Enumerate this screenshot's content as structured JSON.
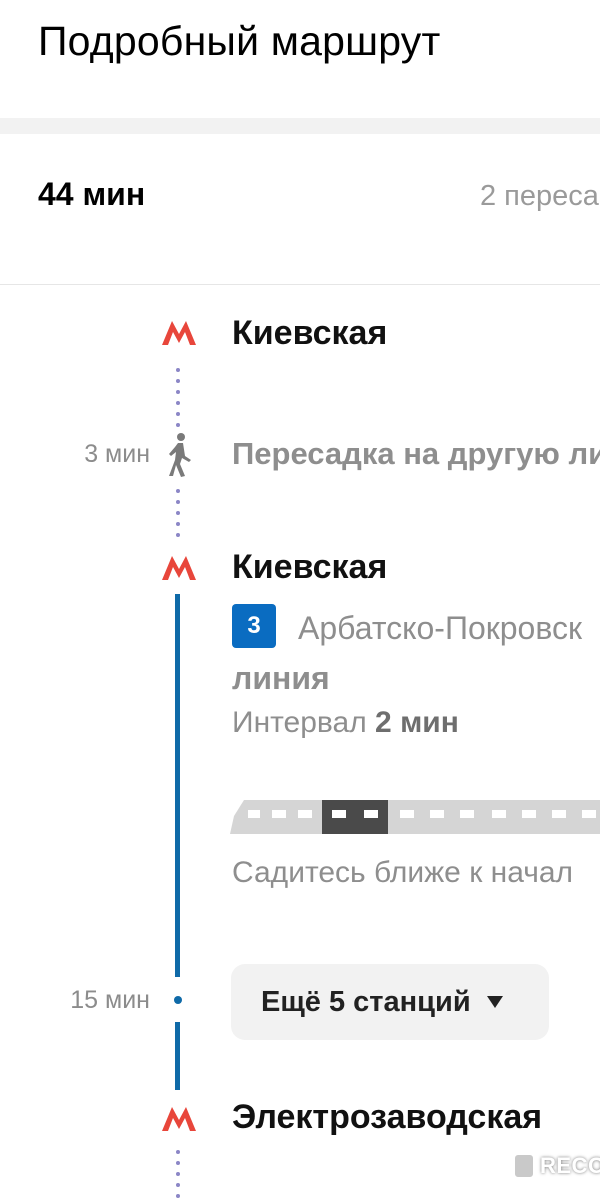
{
  "header": {
    "title": "Подробный маршрут"
  },
  "summary": {
    "duration": "44 мин",
    "transfers": "2 переса"
  },
  "route": {
    "stations": [
      {
        "name": "Киевская"
      },
      {
        "name": "Киевская"
      },
      {
        "name": "Электрозаводская"
      }
    ],
    "transfer": {
      "time": "3 мин",
      "text": "Пересадка на другую ли"
    },
    "ride": {
      "line_number": "3",
      "line_color": "#0a6cc1",
      "line_name_part1": "Арбатско-Покровск",
      "line_name_part2": "линия",
      "interval_label": "Интервал",
      "interval_value": "2 мин",
      "sit_hint": "Садитесь ближе к начал",
      "time": "15 мин",
      "more_stations_label": "Ещё 5 станций"
    }
  },
  "colors": {
    "metro_red": "#e8463b",
    "walk_dots": "#8b86c6",
    "line_blue": "#0f6aa8"
  },
  "watermark": {
    "text": "RECOM"
  }
}
